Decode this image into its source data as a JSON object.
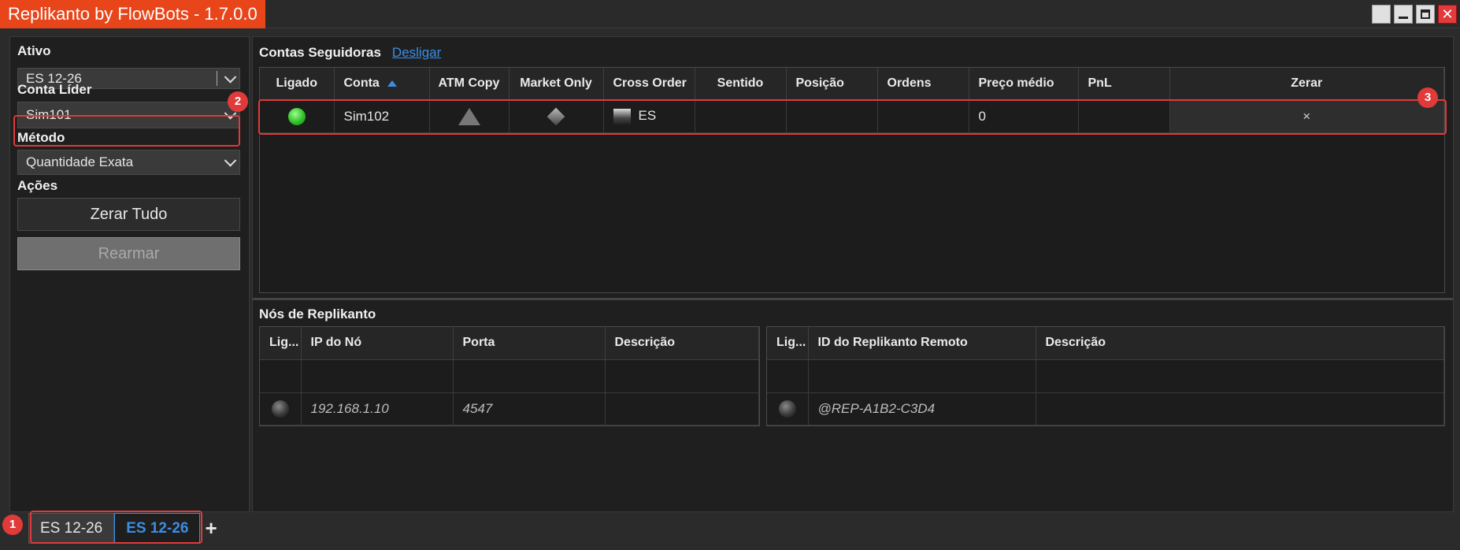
{
  "app": {
    "title": "Replikanto by FlowBots - 1.7.0.0"
  },
  "left": {
    "ativo_label": "Ativo",
    "ativo_value": "ES 12-26",
    "conta_lider_label": "Conta Líder",
    "conta_lider_value": "Sim101",
    "metodo_label": "Método",
    "metodo_value": "Quantidade Exata",
    "acoes_label": "Ações",
    "zerar_tudo": "Zerar Tudo",
    "rearmar": "Rearmar"
  },
  "followers": {
    "title": "Contas Seguidoras",
    "link": "Desligar",
    "columns": [
      "Ligado",
      "Conta",
      "ATM Copy",
      "Market Only",
      "Cross Order",
      "Sentido",
      "Posição",
      "Ordens",
      "Preço médio",
      "PnL",
      "Zerar"
    ],
    "rows": [
      {
        "ligado": "green-dot",
        "conta": "Sim102",
        "atm_copy": "triangle-icon",
        "market_only": "diamond-icon",
        "cross_order": "ES",
        "sentido": "",
        "posicao": "",
        "ordens": "",
        "preco_medio": "0",
        "pnl": "",
        "zerar": "×"
      }
    ]
  },
  "nodes": {
    "title": "Nós de Replikanto",
    "left_columns": [
      "Lig...",
      "IP do Nó",
      "Porta",
      "Descrição"
    ],
    "left_row": {
      "ip": "192.168.1.10",
      "porta": "4547",
      "descricao": ""
    },
    "right_columns": [
      "Lig...",
      "ID do Replikanto Remoto",
      "Descrição"
    ],
    "right_row": {
      "id": "@REP-A1B2-C3D4",
      "descricao": ""
    }
  },
  "tabs": [
    "ES 12-26",
    "ES 12-26"
  ],
  "badges": [
    "1",
    "2",
    "3"
  ],
  "colors": {
    "accent": "#e8461a",
    "link": "#3a8ee6",
    "annotation": "#e03a3a",
    "status_on": "#2fbf2a"
  }
}
